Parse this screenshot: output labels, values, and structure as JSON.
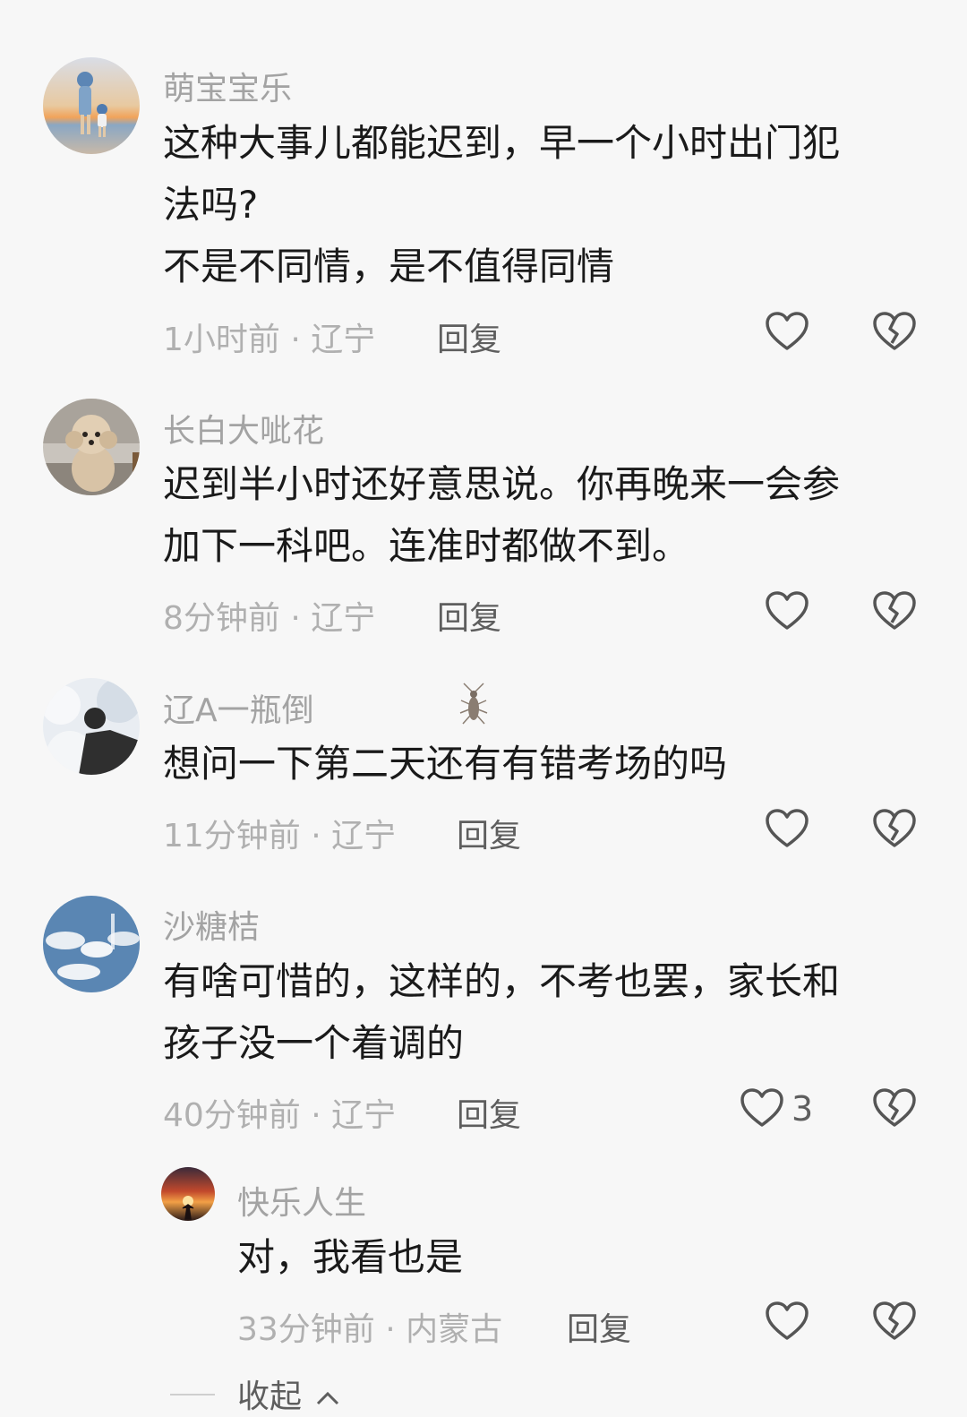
{
  "comments": [
    {
      "username": "萌宝宝乐",
      "lines": [
        "这种大事儿都能迟到，早一个小时出门犯",
        "法吗?",
        "不是不同情，是不值得同情"
      ],
      "meta": "1小时前 · 辽宁",
      "reply": "回复",
      "like_count": ""
    },
    {
      "username": "长白大呲花",
      "lines": [
        "迟到半小时还好意思说。你再晚来一会参",
        "加下一科吧。连准时都做不到。"
      ],
      "meta": "8分钟前 · 辽宁",
      "reply": "回复",
      "like_count": ""
    },
    {
      "username": "辽A一瓶倒",
      "lines": [
        "想问一下第二天还有有错考场的吗"
      ],
      "meta": "11分钟前 · 辽宁",
      "reply": "回复",
      "like_count": ""
    },
    {
      "username": "沙糖桔",
      "lines": [
        "有啥可惜的，这样的，不考也罢，家长和",
        "孩子没一个着调的"
      ],
      "meta": "40分钟前 · 辽宁",
      "reply": "回复",
      "like_count": "3"
    }
  ],
  "sub_reply": {
    "username": "快乐人生",
    "lines": [
      "对，我看也是"
    ],
    "meta": "33分钟前 · 内蒙古",
    "reply": "回复"
  },
  "collapse_label": "收起",
  "colors": {
    "background": "#f7f7f7",
    "username": "#a3a3a3",
    "text": "#1a1a1a",
    "meta": "#b0b0b0",
    "action": "#5e5e5e"
  },
  "icons": [
    "heart-outline-icon",
    "broken-heart-icon",
    "chevron-up-icon",
    "insect-icon"
  ]
}
